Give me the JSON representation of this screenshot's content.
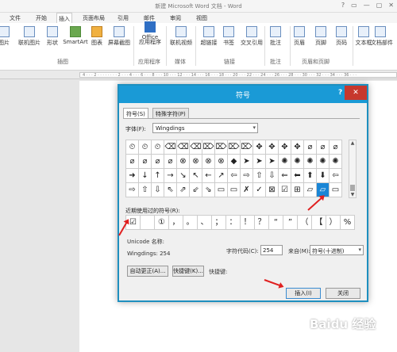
{
  "window": {
    "title": "新建 Microsoft Word 文档 - Word",
    "controls": [
      "?",
      "▭",
      "—",
      "▢",
      "✕"
    ]
  },
  "ribbon_tabs": [
    "文件",
    "开始",
    "插入",
    "页面布局",
    "引用",
    "邮件",
    "审阅",
    "视图"
  ],
  "ribbon": {
    "buttons": [
      {
        "label": "图片",
        "icon": "picture-icon"
      },
      {
        "label": "联机图片",
        "icon": "online-picture-icon"
      },
      {
        "label": "形状",
        "icon": "shapes-icon"
      },
      {
        "label": "SmartArt",
        "icon": "smartart-icon"
      },
      {
        "label": "图表",
        "icon": "chart-icon"
      },
      {
        "label": "屏幕截图",
        "icon": "screenshot-icon"
      },
      {
        "label": "Office",
        "icon": "office-store-icon"
      },
      {
        "label": "应用程序",
        "icon": "apps-icon"
      },
      {
        "label": "联机视频",
        "icon": "online-video-icon"
      },
      {
        "label": "超链接",
        "icon": "hyperlink-icon"
      },
      {
        "label": "书签",
        "icon": "bookmark-icon"
      },
      {
        "label": "交叉引用",
        "icon": "cross-reference-icon"
      },
      {
        "label": "批注",
        "icon": "comment-icon"
      },
      {
        "label": "页眉",
        "icon": "header-icon"
      },
      {
        "label": "页脚",
        "icon": "footer-icon"
      },
      {
        "label": "页码",
        "icon": "page-number-icon"
      },
      {
        "label": "文本框",
        "icon": "textbox-icon"
      },
      {
        "label": "文档部件",
        "icon": "quick-parts-icon"
      }
    ],
    "groups": [
      "插图",
      "应用程序",
      "媒体",
      "链接",
      "批注",
      "页眉和页脚"
    ]
  },
  "ruler_text": "4 · · · 2 · · · · · · · · 2 · · · 4 · · · 6 · · · 8 · · · 10 · · · 12 · · · 14 · · · 16 · · · 18 · · · 20 · · · 22 · · · 24 · · · 26 · · · 28 · · · 30 · · · 32 · · · 34 · · · 36 · · ·",
  "dialog": {
    "title": "符号",
    "help": "?",
    "close": "✕",
    "tabs": [
      "符号(S)",
      "特殊字符(P)"
    ],
    "font_label": "字体(F):",
    "font_value": "Wingdings",
    "symbols": [
      [
        "⏲",
        "⏲",
        "⏲",
        "⌫",
        "⌫",
        "⌫",
        "⌦",
        "⌦",
        "⌦",
        "⌦",
        "✥",
        "✥",
        "✥",
        "✥",
        "⌀",
        "⌀",
        "⌀"
      ],
      [
        "⌀",
        "⌀",
        "⌀",
        "⌀",
        "⊗",
        "⊗",
        "⊗",
        "⊗",
        "◆",
        "➤",
        "➤",
        "➤",
        "✺",
        "✺",
        "✺",
        "✺",
        "✺"
      ],
      [
        "➜",
        "↓",
        "↑",
        "→",
        "↘",
        "↖",
        "←",
        "↗",
        "⇦",
        "⇨",
        "⇧",
        "⇩",
        "⇐",
        "⬅",
        "⬆",
        "⬇",
        "⇦"
      ],
      [
        "⇨",
        "⇧",
        "⇩",
        "⇖",
        "⇗",
        "⇙",
        "⇘",
        "▭",
        "▭",
        "✗",
        "✓",
        "⊠",
        "☑",
        "⊞",
        "▱",
        "▱",
        "▭"
      ]
    ],
    "selected_symbol": "☑",
    "recent_label": "近期使用过的符号(R):",
    "recent_symbols": [
      "☑",
      "",
      "①",
      "，",
      "。",
      "、",
      "；",
      "：",
      "！",
      "？",
      "“",
      "”",
      "（",
      "【",
      "）",
      "%"
    ],
    "unicode_name_label": "Unicode 名称:",
    "unicode_value": "Wingdings: 254",
    "char_code_label": "字符代码(C):",
    "char_code_value": "254",
    "from_label": "来自(M):",
    "from_value": "符号(十进制)",
    "autocorrect_button": "自动更正(A)...",
    "shortcut_key_button": "快捷键(K)...",
    "shortcut_key_label": "快捷键:",
    "insert_button": "插入(I)",
    "close_button": "关闭"
  },
  "watermark": "Baidu 经验"
}
